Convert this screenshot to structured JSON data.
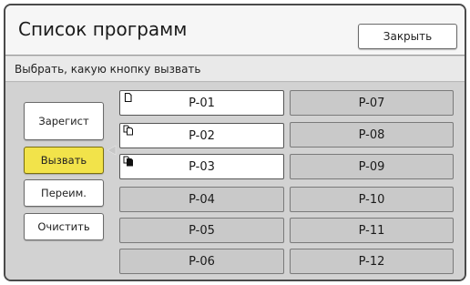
{
  "header": {
    "title": "Список программ",
    "close_label": "Закрыть"
  },
  "subtitle": "Выбрать, какую кнопку вызвать",
  "side_buttons": {
    "register": "Зарегист",
    "call": "Вызвать",
    "rename": "Переим.",
    "clear": "Очистить"
  },
  "programs": {
    "p01": "P-01",
    "p02": "P-02",
    "p03": "P-03",
    "p04": "P-04",
    "p05": "P-05",
    "p06": "P-06",
    "p07": "P-07",
    "p08": "P-08",
    "p09": "P-09",
    "p10": "P-10",
    "p11": "P-11",
    "p12": "P-12"
  },
  "colors": {
    "active_button": "#f2e34a",
    "registered_button": "#ffffff",
    "empty_button": "#c9c9c9"
  },
  "icons": {
    "p01": "single-page-icon",
    "p02": "multi-page-icon",
    "p03": "multi-page-filled-icon",
    "pointer": "left-arrow-icon"
  }
}
